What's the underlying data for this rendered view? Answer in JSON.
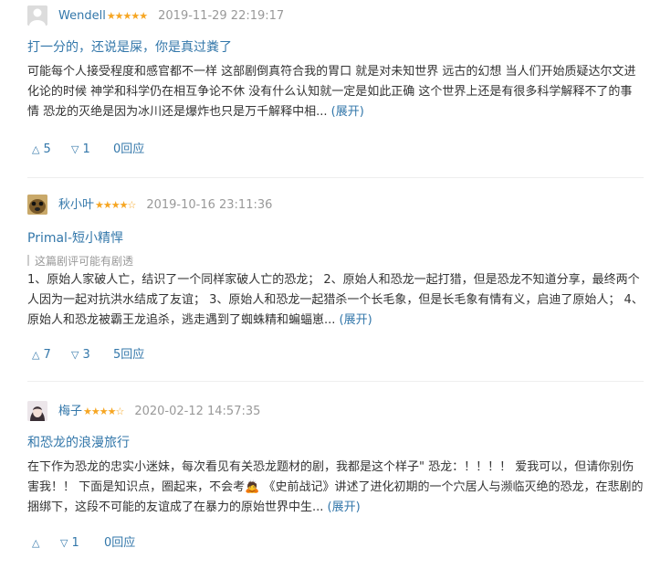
{
  "reviews": [
    {
      "author": "Wendell",
      "stars": "★★★★★",
      "time": "2019-11-29 22:19:17",
      "title": "打一分的，还说是屎，你是真过粪了",
      "body": "可能每个人接受程度和感官都不一样 这部剧倒真符合我的胃口 就是对未知世界 远古的幻想 当人们开始质疑达尔文进化论的时候 神学和科学仍在相互争论不休 没有什么认知就一定是如此正确 这个世界上还是有很多科学解释不了的事情 恐龙的灭绝是因为冰川还是爆炸也只是万千解释中相...",
      "expand": "(展开)",
      "up_icon": "△",
      "useful": "5",
      "down_icon": "▽",
      "useless": "1",
      "replies": "0回应"
    },
    {
      "author": "秋小叶",
      "stars": "★★★★☆",
      "time": "2019-10-16 23:11:36",
      "title": "Primal-短小精悍",
      "spoiler": "这篇剧评可能有剧透",
      "body": "1、原始人家破人亡，结识了一个同样家破人亡的恐龙； 2、原始人和恐龙一起打猎，但是恐龙不知道分享，最终两个人因为一起对抗洪水结成了友谊； 3、原始人和恐龙一起猎杀一个长毛象，但是长毛象有情有义，启迪了原始人； 4、原始人和恐龙被霸王龙追杀，逃走遇到了蜘蛛精和蝙蝠崽...",
      "expand": "(展开)",
      "up_icon": "△",
      "useful": "7",
      "down_icon": "▽",
      "useless": "3",
      "replies": "5回应"
    },
    {
      "author": "梅子",
      "stars": "★★★★☆",
      "time": "2020-02-12 14:57:35",
      "title": "和恐龙的浪漫旅行",
      "body": "在下作为恐龙的忠实小迷妹，每次看见有关恐龙题材的剧，我都是这个样子\" 恐龙：！！！！ 爱我可以，但请你别伤害我！！ 下面是知识点，圈起来，不会考🙇 《史前战记》讲述了进化初期的一个穴居人与濒临灭绝的恐龙，在悲剧的捆绑下，这段不可能的友谊成了在暴力的原始世界中生...",
      "expand": "(展开)",
      "up_icon": "△",
      "useful": "",
      "down_icon": "▽",
      "useless": "1",
      "replies": "0回应"
    }
  ]
}
